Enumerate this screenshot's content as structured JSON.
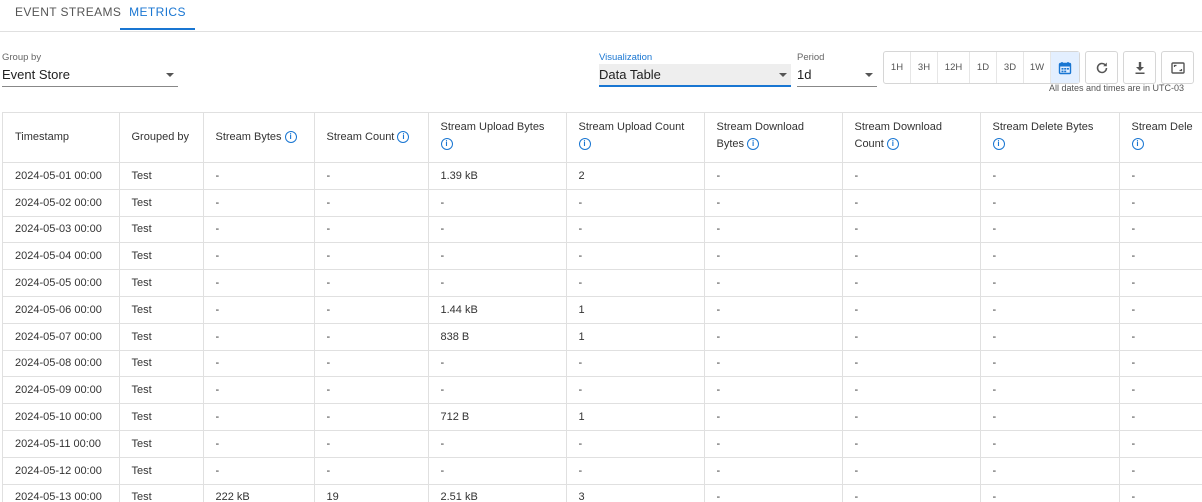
{
  "tabs": [
    {
      "label": "EVENT STREAMS",
      "active": false
    },
    {
      "label": "METRICS",
      "active": true
    }
  ],
  "toolbar": {
    "group_by": {
      "label": "Group by",
      "value": "Event Store"
    },
    "visualization": {
      "label": "Visualization",
      "value": "Data Table"
    },
    "period": {
      "label": "Period",
      "value": "1d"
    },
    "period_buttons": [
      "1H",
      "3H",
      "12H",
      "1D",
      "3D",
      "1W"
    ],
    "icons": {
      "calendar": "calendar-icon",
      "refresh": "refresh-icon",
      "download": "download-icon",
      "fullscreen": "fullscreen-icon"
    },
    "timezone_note": "All dates and times are in UTC-03"
  },
  "table": {
    "headers": [
      "Timestamp",
      "Grouped by",
      "Stream Bytes",
      "Stream Count",
      "Stream Upload Bytes",
      "Stream Upload Count",
      "Stream Download Bytes",
      "Stream Download Count",
      "Stream Delete Bytes",
      "Stream Dele"
    ],
    "rows": [
      [
        "2024-05-01 00:00",
        "Test",
        "-",
        "-",
        "1.39 kB",
        "2",
        "-",
        "-",
        "-",
        "-"
      ],
      [
        "2024-05-02 00:00",
        "Test",
        "-",
        "-",
        "-",
        "-",
        "-",
        "-",
        "-",
        "-"
      ],
      [
        "2024-05-03 00:00",
        "Test",
        "-",
        "-",
        "-",
        "-",
        "-",
        "-",
        "-",
        "-"
      ],
      [
        "2024-05-04 00:00",
        "Test",
        "-",
        "-",
        "-",
        "-",
        "-",
        "-",
        "-",
        "-"
      ],
      [
        "2024-05-05 00:00",
        "Test",
        "-",
        "-",
        "-",
        "-",
        "-",
        "-",
        "-",
        "-"
      ],
      [
        "2024-05-06 00:00",
        "Test",
        "-",
        "-",
        "1.44 kB",
        "1",
        "-",
        "-",
        "-",
        "-"
      ],
      [
        "2024-05-07 00:00",
        "Test",
        "-",
        "-",
        "838 B",
        "1",
        "-",
        "-",
        "-",
        "-"
      ],
      [
        "2024-05-08 00:00",
        "Test",
        "-",
        "-",
        "-",
        "-",
        "-",
        "-",
        "-",
        "-"
      ],
      [
        "2024-05-09 00:00",
        "Test",
        "-",
        "-",
        "-",
        "-",
        "-",
        "-",
        "-",
        "-"
      ],
      [
        "2024-05-10 00:00",
        "Test",
        "-",
        "-",
        "712 B",
        "1",
        "-",
        "-",
        "-",
        "-"
      ],
      [
        "2024-05-11 00:00",
        "Test",
        "-",
        "-",
        "-",
        "-",
        "-",
        "-",
        "-",
        "-"
      ],
      [
        "2024-05-12 00:00",
        "Test",
        "-",
        "-",
        "-",
        "-",
        "-",
        "-",
        "-",
        "-"
      ],
      [
        "2024-05-13 00:00",
        "Test",
        "222 kB",
        "19",
        "2.51 kB",
        "3",
        "-",
        "-",
        "-",
        "-"
      ]
    ]
  }
}
